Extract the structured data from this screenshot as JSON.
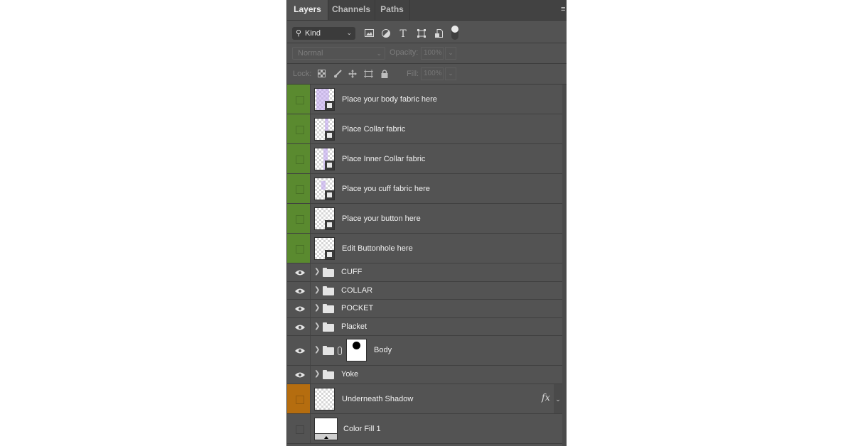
{
  "panel": {
    "tabs": [
      {
        "label": "Layers",
        "active": true
      },
      {
        "label": "Channels",
        "active": false
      },
      {
        "label": "Paths",
        "active": false
      }
    ],
    "filter": {
      "kind_label": "Kind",
      "icons": [
        "image-filter-icon",
        "adjustment-filter-icon",
        "type-filter-icon",
        "shape-filter-icon",
        "smart-object-filter-icon"
      ]
    },
    "blend_mode": "Normal",
    "opacity_label": "Opacity:",
    "opacity_value": "100%",
    "lock_label": "Lock:",
    "fill_label": "Fill:",
    "fill_value": "100%"
  },
  "layers": [
    {
      "name": "Place your body fabric here",
      "type": "smart-object",
      "color": "#5a8a2f",
      "visible": false
    },
    {
      "name": "Place Collar fabric",
      "type": "smart-object",
      "color": "#5a8a2f",
      "visible": false
    },
    {
      "name": "Place Inner Collar fabric",
      "type": "smart-object",
      "color": "#5a8a2f",
      "visible": false
    },
    {
      "name": "Place you cuff fabric here",
      "type": "smart-object",
      "color": "#5a8a2f",
      "visible": false
    },
    {
      "name": "Place your button here",
      "type": "smart-object",
      "color": "#5a8a2f",
      "visible": false
    },
    {
      "name": "Edit Buttonhole here",
      "type": "smart-object",
      "color": "#5a8a2f",
      "visible": false
    },
    {
      "name": "CUFF",
      "type": "group",
      "visible": true
    },
    {
      "name": "COLLAR",
      "type": "group",
      "visible": true
    },
    {
      "name": "POCKET",
      "type": "group",
      "visible": true
    },
    {
      "name": "Placket",
      "type": "group",
      "visible": true
    },
    {
      "name": "Body",
      "type": "group-with-mask",
      "visible": true
    },
    {
      "name": "Yoke",
      "type": "group",
      "visible": true
    },
    {
      "name": "Underneath Shadow",
      "type": "layer-fx",
      "color": "#b56d0f",
      "visible": false,
      "fx": "fx"
    },
    {
      "name": "Color Fill 1",
      "type": "fill",
      "visible": false
    }
  ]
}
